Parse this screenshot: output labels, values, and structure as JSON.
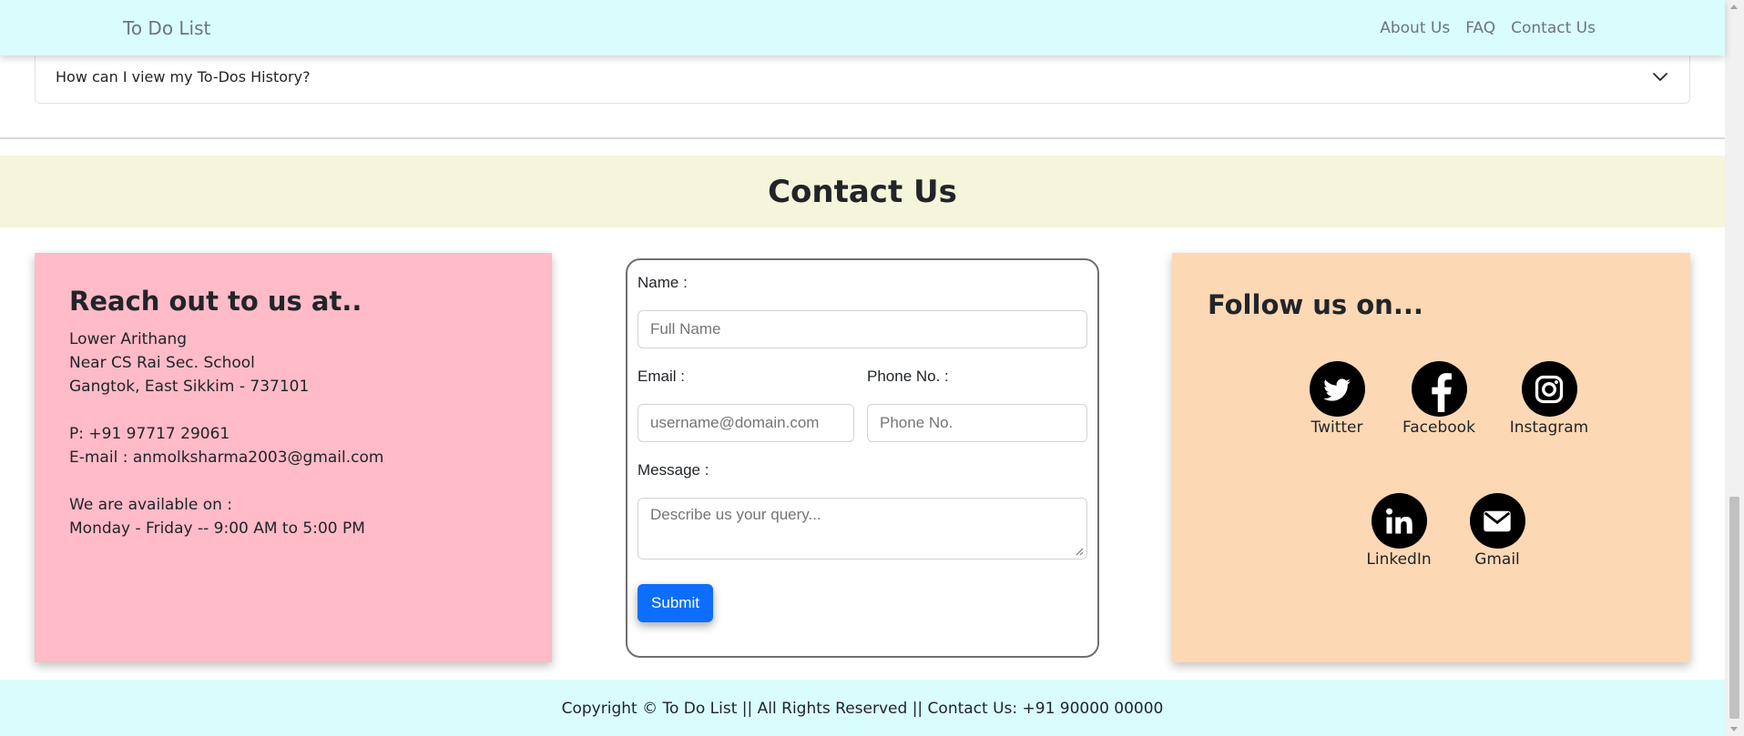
{
  "navbar": {
    "brand": "To Do List",
    "links": [
      "About Us",
      "FAQ",
      "Contact Us"
    ]
  },
  "faq": {
    "question": "How can I view my To-Dos History?"
  },
  "contact": {
    "title": "Contact Us"
  },
  "reach": {
    "heading": "Reach out to us at..",
    "address": [
      "Lower Arithang",
      "Near CS Rai Sec. School",
      "Gangtok, East Sikkim - 737101"
    ],
    "phone": "P: +91 97717 29061",
    "email": "E-mail : anmolksharma2003@gmail.com",
    "availability_label": "We are available on :",
    "availability_hours": "Monday - Friday -- 9:00 AM to 5:00 PM"
  },
  "form": {
    "name_label": "Name :",
    "name_placeholder": "Full Name",
    "email_label": "Email :",
    "email_placeholder": "username@domain.com",
    "phone_label": "Phone No. :",
    "phone_placeholder": "Phone No.",
    "message_label": "Message :",
    "message_placeholder": "Describe us your query...",
    "submit_label": "Submit",
    "submit_color": "#0d6efd"
  },
  "follow": {
    "heading": "Follow us on...",
    "socials": [
      {
        "name": "Twitter",
        "icon": "twitter-icon"
      },
      {
        "name": "Facebook",
        "icon": "facebook-icon"
      },
      {
        "name": "Instagram",
        "icon": "instagram-icon"
      },
      {
        "name": "LinkedIn",
        "icon": "linkedin-icon"
      },
      {
        "name": "Gmail",
        "icon": "gmail-icon"
      }
    ]
  },
  "footer": {
    "text": "Copyright © To Do List || All Rights Reserved || Contact Us: +91 90000 00000"
  },
  "colors": {
    "navbar_bg": "#d9fcfd",
    "contact_band_bg": "#f5f5db",
    "reach_bg": "#ffbbc7",
    "follow_bg": "#fdd8b5"
  }
}
